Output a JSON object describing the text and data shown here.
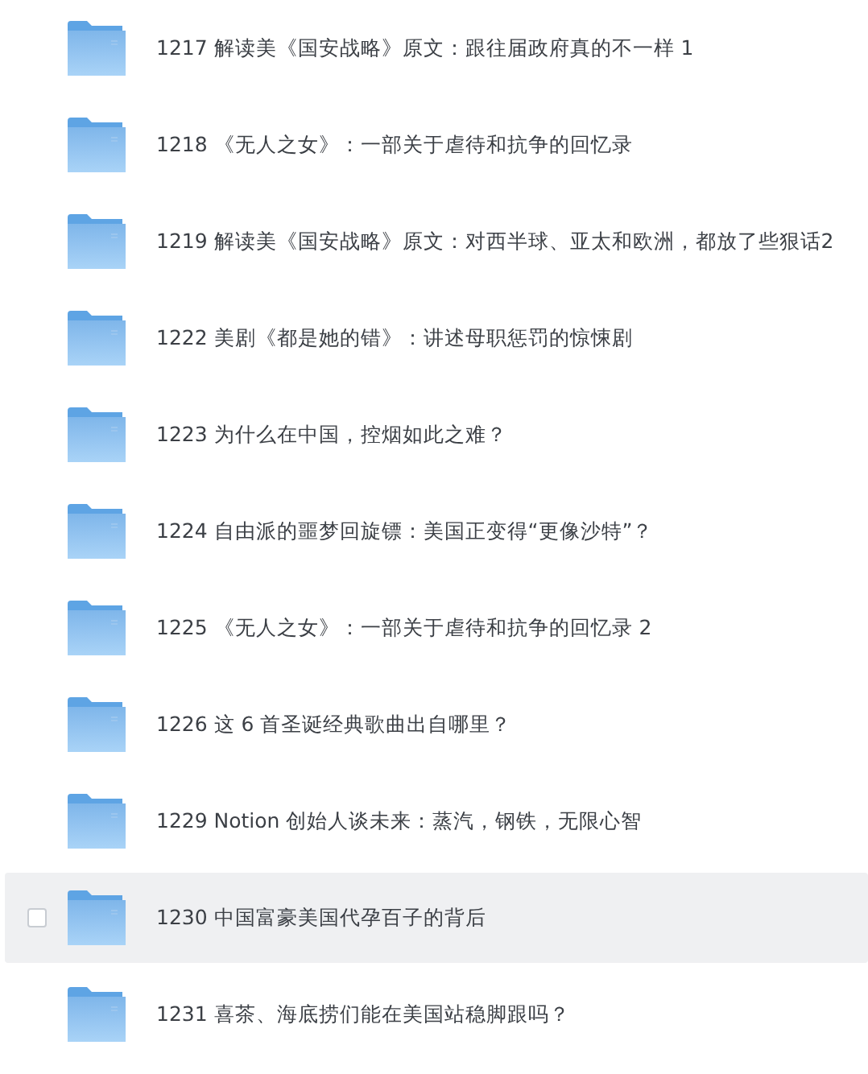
{
  "folders": [
    {
      "name": "1217 解读美《国安战略》原文：跟往届政府真的不一样 1",
      "hovered": false,
      "checked": false
    },
    {
      "name": "1218 《无人之女》：一部关于虐待和抗争的回忆录",
      "hovered": false,
      "checked": false
    },
    {
      "name": "1219 解读美《国安战略》原文：对西半球、亚太和欧洲，都放了些狠话2",
      "hovered": false,
      "checked": false
    },
    {
      "name": "1222 美剧《都是她的错》：讲述母职惩罚的惊悚剧",
      "hovered": false,
      "checked": false
    },
    {
      "name": "1223 为什么在中国，控烟如此之难？",
      "hovered": false,
      "checked": false
    },
    {
      "name": "1224 自由派的噩梦回旋镖：美国正变得“更像沙特”？",
      "hovered": false,
      "checked": false
    },
    {
      "name": "1225 《无人之女》：一部关于虐待和抗争的回忆录 2",
      "hovered": false,
      "checked": false
    },
    {
      "name": "1226 这 6 首圣诞经典歌曲出自哪里？",
      "hovered": false,
      "checked": false
    },
    {
      "name": "1229 Notion 创始人谈未来：蒸汽，钢铁，无限心智",
      "hovered": false,
      "checked": false
    },
    {
      "name": "1230 中国富豪美国代孕百子的背后",
      "hovered": true,
      "checked": false
    },
    {
      "name": "1231 喜茶、海底捞们能在美国站稳脚跟吗？",
      "hovered": false,
      "checked": false
    }
  ]
}
